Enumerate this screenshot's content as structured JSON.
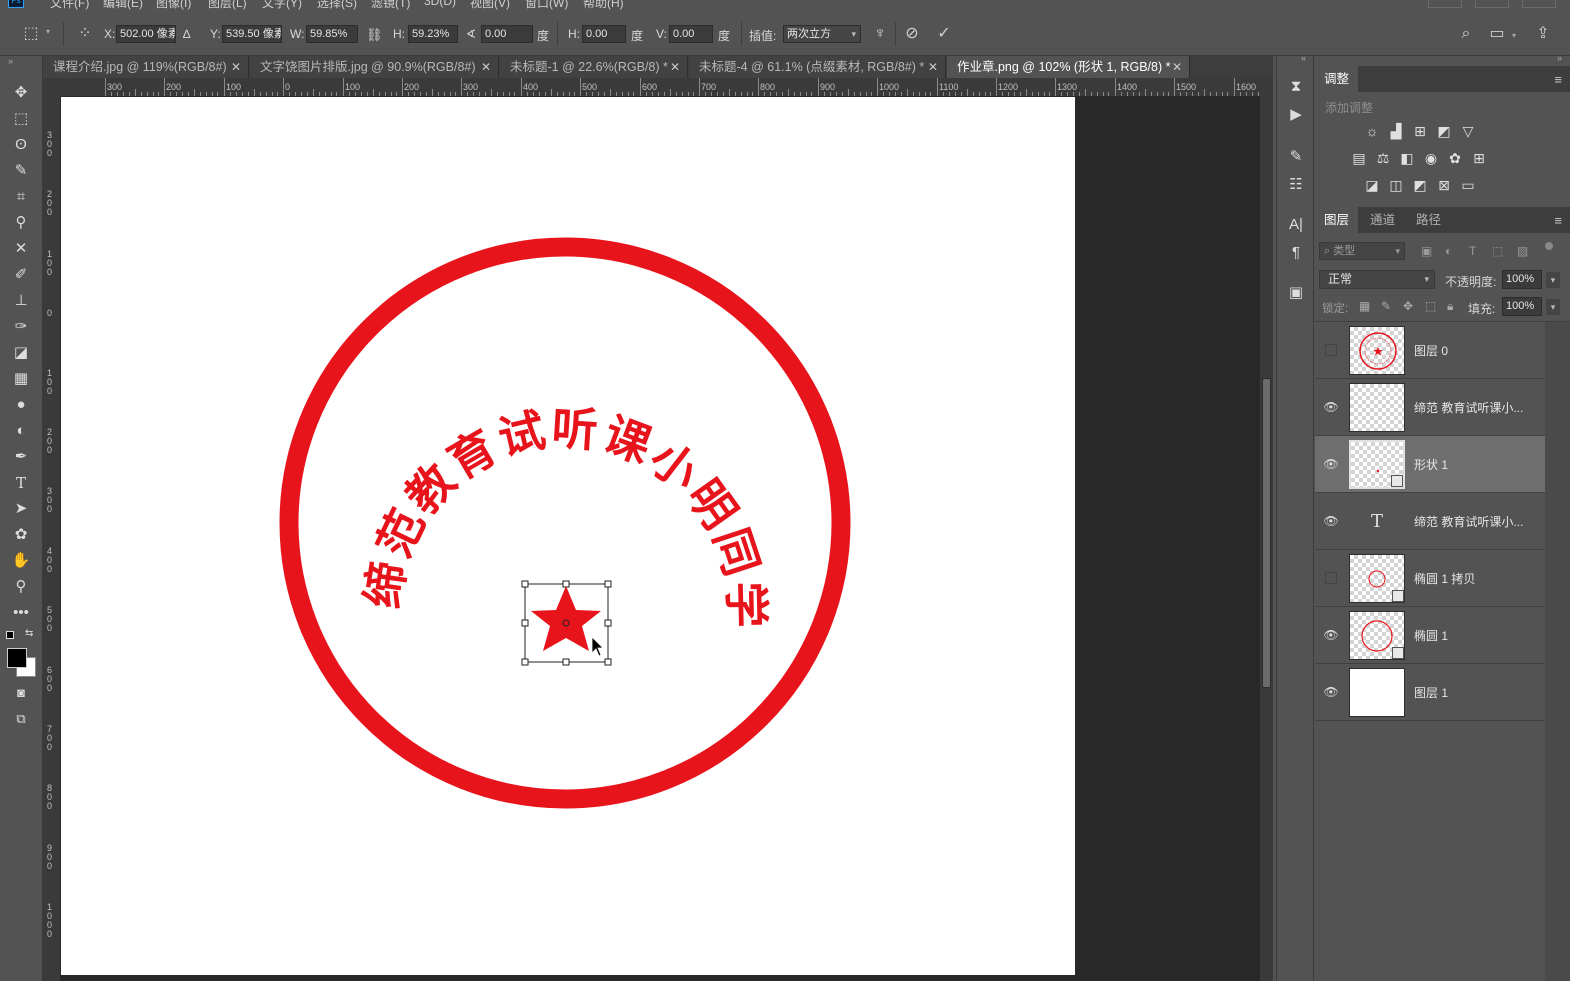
{
  "menubar": {
    "items": [
      "文件(F)",
      "编辑(E)",
      "图像(I)",
      "图层(L)",
      "文字(Y)",
      "选择(S)",
      "滤镜(T)",
      "3D(D)",
      "视图(V)",
      "窗口(W)",
      "帮助(H)"
    ]
  },
  "options": {
    "x_label": "X:",
    "x_value": "502.00 像素",
    "y_label": "Y:",
    "y_value": "539.50 像素",
    "w_label": "W:",
    "w_value": "59.85%",
    "h_label": "H:",
    "h_value": "59.23%",
    "angle_value": "0.00",
    "degree": "度",
    "hskew_label": "H:",
    "hskew_value": "0.00",
    "vskew_label": "V:",
    "vskew_value": "0.00",
    "interp_label": "插值:",
    "interp_value": "两次立方"
  },
  "tabs": [
    {
      "label": "课程介绍.jpg @ 119%(RGB/8#)",
      "active": false
    },
    {
      "label": "文字饶图片排版.jpg @ 90.9%(RGB/8#)",
      "active": false
    },
    {
      "label": "未标题-1 @ 22.6%(RGB/8) *",
      "active": false
    },
    {
      "label": "未标题-4 @ 61.1% (点缀素材, RGB/8#) *",
      "active": false
    },
    {
      "label": "作业章.png @ 102% (形状 1, RGB/8) *",
      "active": true
    }
  ],
  "ruler": {
    "h_labels": [
      "300",
      "200",
      "100",
      "0",
      "100",
      "200",
      "300",
      "400",
      "500",
      "600",
      "700",
      "800",
      "900",
      "1000",
      "1100",
      "1200",
      "1300",
      "1400",
      "1500",
      "1600"
    ],
    "v_labels": [
      "300",
      "200",
      "100",
      "0",
      "100",
      "200",
      "300",
      "400",
      "500",
      "600",
      "700",
      "800",
      "900",
      "1000"
    ]
  },
  "canvas": {
    "stamp_text": "缔范教育试听课小明同学",
    "stamp_color": "#e8141c"
  },
  "adjustments": {
    "tab": "调整",
    "add_label": "添加调整"
  },
  "layers_panel": {
    "tabs": [
      "图层",
      "通道",
      "路径"
    ],
    "filter_placeholder": "类型",
    "blend_mode": "正常",
    "opacity_label": "不透明度:",
    "opacity_value": "100%",
    "lock_label": "锁定:",
    "fill_label": "填充:",
    "fill_value": "100%",
    "layers": [
      {
        "name": "图层 0",
        "visible": false,
        "thumb": "stamp"
      },
      {
        "name": "缔范 教育试听课小...",
        "visible": true,
        "thumb": "transparent"
      },
      {
        "name": "形状 1",
        "visible": true,
        "thumb": "shape",
        "selected": true
      },
      {
        "name": "缔范 教育试听课小...",
        "visible": true,
        "thumb": "text"
      },
      {
        "name": "椭圆 1 拷贝",
        "visible": false,
        "thumb": "ellipse-small"
      },
      {
        "name": "椭圆 1",
        "visible": true,
        "thumb": "ellipse"
      },
      {
        "name": "图层 1",
        "visible": true,
        "thumb": "white"
      }
    ]
  }
}
